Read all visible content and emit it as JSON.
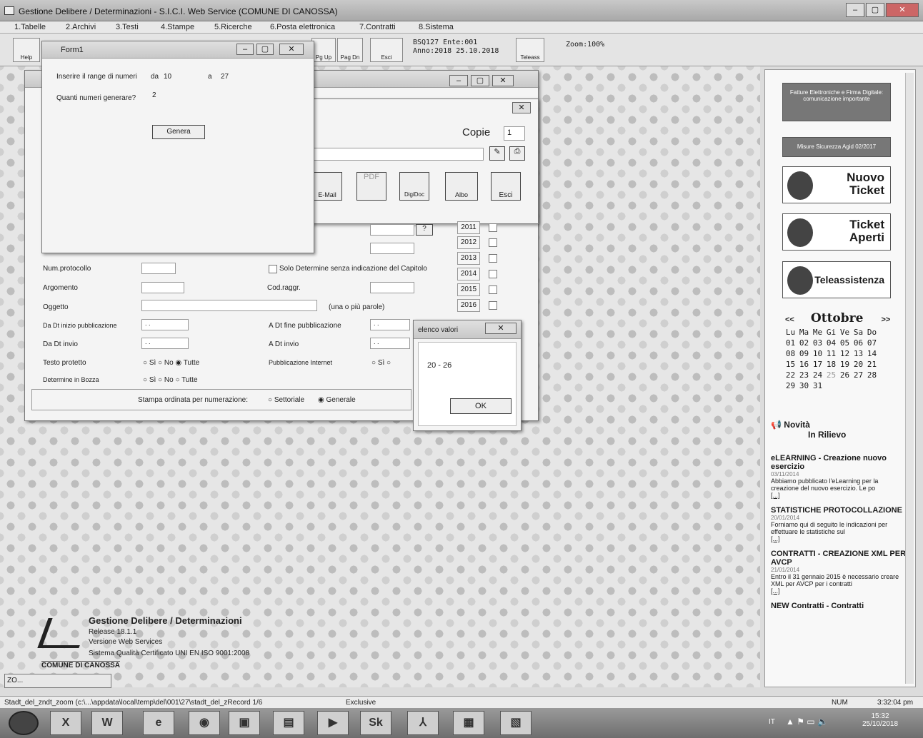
{
  "app": {
    "title": "Gestione Delibere / Determinazioni - S.I.C.I. Web Service (COMUNE DI CANOSSA)"
  },
  "menu": [
    "1.Tabelle",
    "2.Archivi",
    "3.Testi",
    "4.Stampe",
    "5.Ricerche",
    "6.Posta elettronica",
    "7.Contratti",
    "8.Sistema"
  ],
  "toolbar": {
    "help": "Help",
    "pgup": "Pg Up",
    "pgdn": "Pag Dn",
    "esci": "Esci",
    "info_line1": "BSQ127  Ente:001",
    "info_line2": "Anno:2018 25.10.2018",
    "teleass": "Teleass",
    "zoom": "Zoom:100%"
  },
  "form1": {
    "title": "Form1",
    "range_label": "Inserire il range di numeri",
    "da_label": "da",
    "da_value": "10",
    "a_label": "a",
    "a_value": "27",
    "qty_label": "Quanti numeri generare?",
    "qty_value": "2",
    "generate": "Genera"
  },
  "print": {
    "copies_label": "Copie",
    "copies_value": "1",
    "email": "E-Mail",
    "digidoc": "DigiDoc",
    "albo": "Albo",
    "esci": "Esci",
    "help": "?"
  },
  "search": {
    "years": [
      "2011",
      "2012",
      "2013",
      "2014",
      "2015",
      "2016"
    ],
    "num_protocollo": "Num.protocollo",
    "solo_det": "Solo Determine senza indicazione del Capitolo",
    "argomento": "Argomento",
    "cod_raggr": "Cod.raggr.",
    "oggetto": "Oggetto",
    "oggetto_hint": "(una o più parole)",
    "dt_inizio": "Da Dt inizio pubblicazione",
    "dt_fine": "A Dt fine pubblicazione",
    "date_empty": "  .  .",
    "dt_invio_da": "Da Dt invio",
    "dt_invio_a": "A Dt invio",
    "testo_protetto": "Testo protetto",
    "pub_internet": "Pubblicazione Internet",
    "det_bozza": "Determine in Bozza",
    "si": "Sì",
    "no": "No",
    "tutte": "Tutte",
    "stampa_ord": "Stampa ordinata per numerazione:",
    "settoriale": "Settoriale",
    "generale": "Generale"
  },
  "msg": {
    "title": "elenco valori",
    "text": "20 - 26",
    "ok": "OK"
  },
  "logo": {
    "title": "Gestione Delibere / Determinazioni",
    "release": "Release 18.1.1",
    "version": "Versione Web Services",
    "quality": "Sistema Qualità Certificato UNI EN ISO 9001:2008",
    "ente": "COMUNE DI CANOSSA",
    "minimized": "ZO..."
  },
  "right": {
    "fattura": "Fatture Elettroniche e Firma Digitale: comunicazione importante",
    "misure": "Misure Sicurezza Agid 02/2017",
    "nuovo_ticket_1": "Nuovo",
    "nuovo_ticket_2": "Ticket",
    "ticket_aperti_1": "Ticket",
    "ticket_aperti_2": "Aperti",
    "teleassistenza": "Teleassistenza",
    "month": "Ottobre",
    "prev": "<<",
    "next": ">>",
    "days": [
      "Lu",
      "Ma",
      "Me",
      "Gi",
      "Ve",
      "Sa",
      "Do"
    ],
    "weeks": [
      [
        "01",
        "02",
        "03",
        "04",
        "05",
        "06",
        "07"
      ],
      [
        "08",
        "09",
        "10",
        "11",
        "12",
        "13",
        "14"
      ],
      [
        "15",
        "16",
        "17",
        "18",
        "19",
        "20",
        "21"
      ],
      [
        "22",
        "23",
        "24",
        "25",
        "26",
        "27",
        "28"
      ],
      [
        "29",
        "30",
        "31",
        "",
        "",
        "",
        ""
      ]
    ],
    "novita_1": "Novità",
    "novita_2": "In Rilievo",
    "news": [
      {
        "title": "eLEARNING - Creazione nuovo esercizio",
        "date": "03/11/2014",
        "text": "Abbiamo pubblicato l'eLearning per la creazione del nuovo esercizio. Le po",
        "more": "[...]"
      },
      {
        "title": "STATISTICHE PROTOCOLLAZIONE",
        "date": "20/01/2014",
        "text": "Forniamo qui di seguito le indicazioni per effettuare le statistiche sul",
        "more": "[...]"
      },
      {
        "title": "CONTRATTI - CREAZIONE XML PER AVCP",
        "date": "21/01/2014",
        "text": "Entro il 31 gennaio 2015 è necessario creare XML per AVCP per i contratti",
        "more": "[...]"
      },
      {
        "title": "NEW Contratti - Contratti",
        "date": "",
        "text": "",
        "more": ""
      }
    ]
  },
  "status": {
    "path": "Stadt_del_zndt_zoom (c:\\...\\appdata\\local\\temp\\del\\001\\27\\stadt_del_zRecord 1/6",
    "mode": "Exclusive",
    "num": "NUM",
    "time": "3:32:04 pm"
  },
  "taskbar": {
    "clock": "15:32",
    "date": "25/10/2018",
    "lang": "IT"
  }
}
